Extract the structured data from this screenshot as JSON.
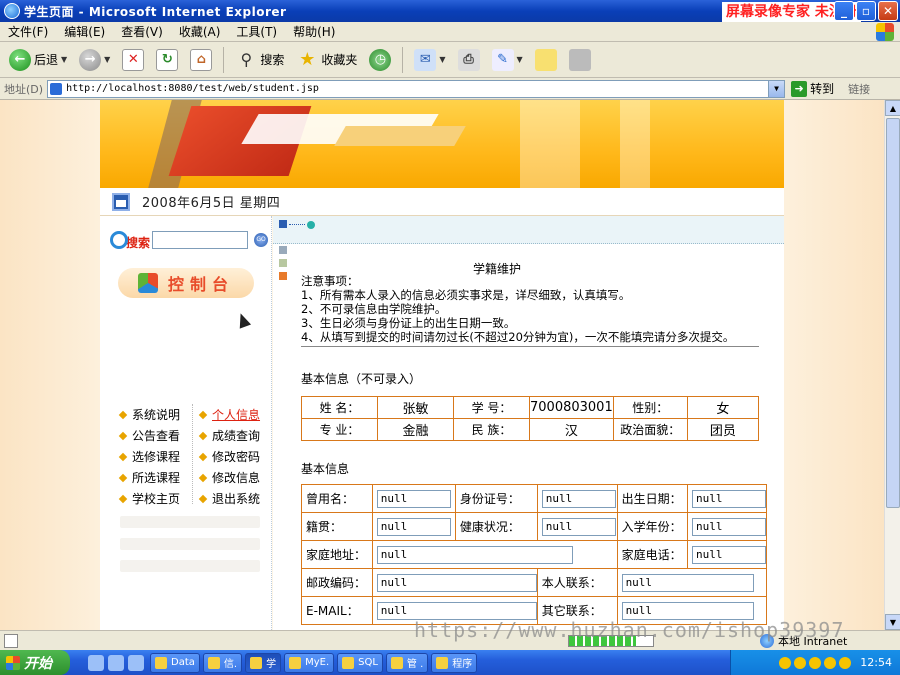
{
  "window": {
    "title": "学生页面 - Microsoft Internet Explorer",
    "promo": "屏幕录像专家 未注册"
  },
  "menu": [
    "文件(F)",
    "编辑(E)",
    "查看(V)",
    "收藏(A)",
    "工具(T)",
    "帮助(H)"
  ],
  "toolbar": {
    "back": "后退",
    "search": "搜索",
    "favorites": "收藏夹"
  },
  "address": {
    "label": "地址(D)",
    "url": "http://localhost:8080/test/web/student.jsp",
    "go": "转到",
    "links": "链接"
  },
  "page": {
    "date": "2008年6月5日  星期四",
    "search_label": "搜索",
    "search_go": "GO",
    "console": "控制台",
    "nav_left": [
      "系统说明",
      "公告查看",
      "选修课程",
      "所选课程",
      "学校主页"
    ],
    "nav_right": [
      "个人信息",
      "成绩查询",
      "修改密码",
      "修改信息",
      "退出系统"
    ],
    "form_title": "学籍维护",
    "notes_title": "注意事项：",
    "notes": [
      "1、所有需本人录入的信息必须实事求是，详尽细致，认真填写。",
      "2、不可录信息由学院维护。",
      "3、生日必须与身份证上的出生日期一致。",
      "4、从填写到提交的时间请勿过长(不超过20分钟为宜)，一次不能填完请分多次提交。"
    ],
    "basic_readonly_label": "基本信息（不可录入）",
    "basic_label": "基本信息",
    "readonly": {
      "name_label": "姓  名：",
      "name": "张敏",
      "id_label": "学  号：",
      "id": "7000803001",
      "gender_label": "性别：",
      "gender": "女",
      "major_label": "专  业：",
      "major": "金融",
      "ethnic_label": "民  族：",
      "ethnic": "汉",
      "political_label": "政治面貌：",
      "political": "团员"
    },
    "editable": {
      "former_name_label": "曾用名：",
      "former_name": "null",
      "idcard_label": "身份证号：",
      "idcard": "null",
      "birth_label": "出生日期：",
      "birth": "null",
      "native_label": "籍贯：",
      "native": "null",
      "health_label": "健康状况：",
      "health": "null",
      "enroll_label": "入学年份：",
      "enroll": "null",
      "address_label": "家庭地址：",
      "address": "null",
      "phone_label": "家庭电话：",
      "phone": "null",
      "postcode_label": "邮政编码：",
      "postcode": "null",
      "contact_label": "本人联系：",
      "contact": "null",
      "email_label": "E-MAIL：",
      "email": "null",
      "other_label": "其它联系：",
      "other": "null"
    }
  },
  "watermark": "https://www.huzhan.com/ishop39397",
  "status": {
    "zone": "本地 Intranet"
  },
  "taskbar": {
    "start": "开始",
    "tasks": [
      "Data",
      "信.",
      "学",
      "MyE.",
      "SQL",
      "管 .",
      "程序"
    ],
    "clock": "12:54"
  }
}
